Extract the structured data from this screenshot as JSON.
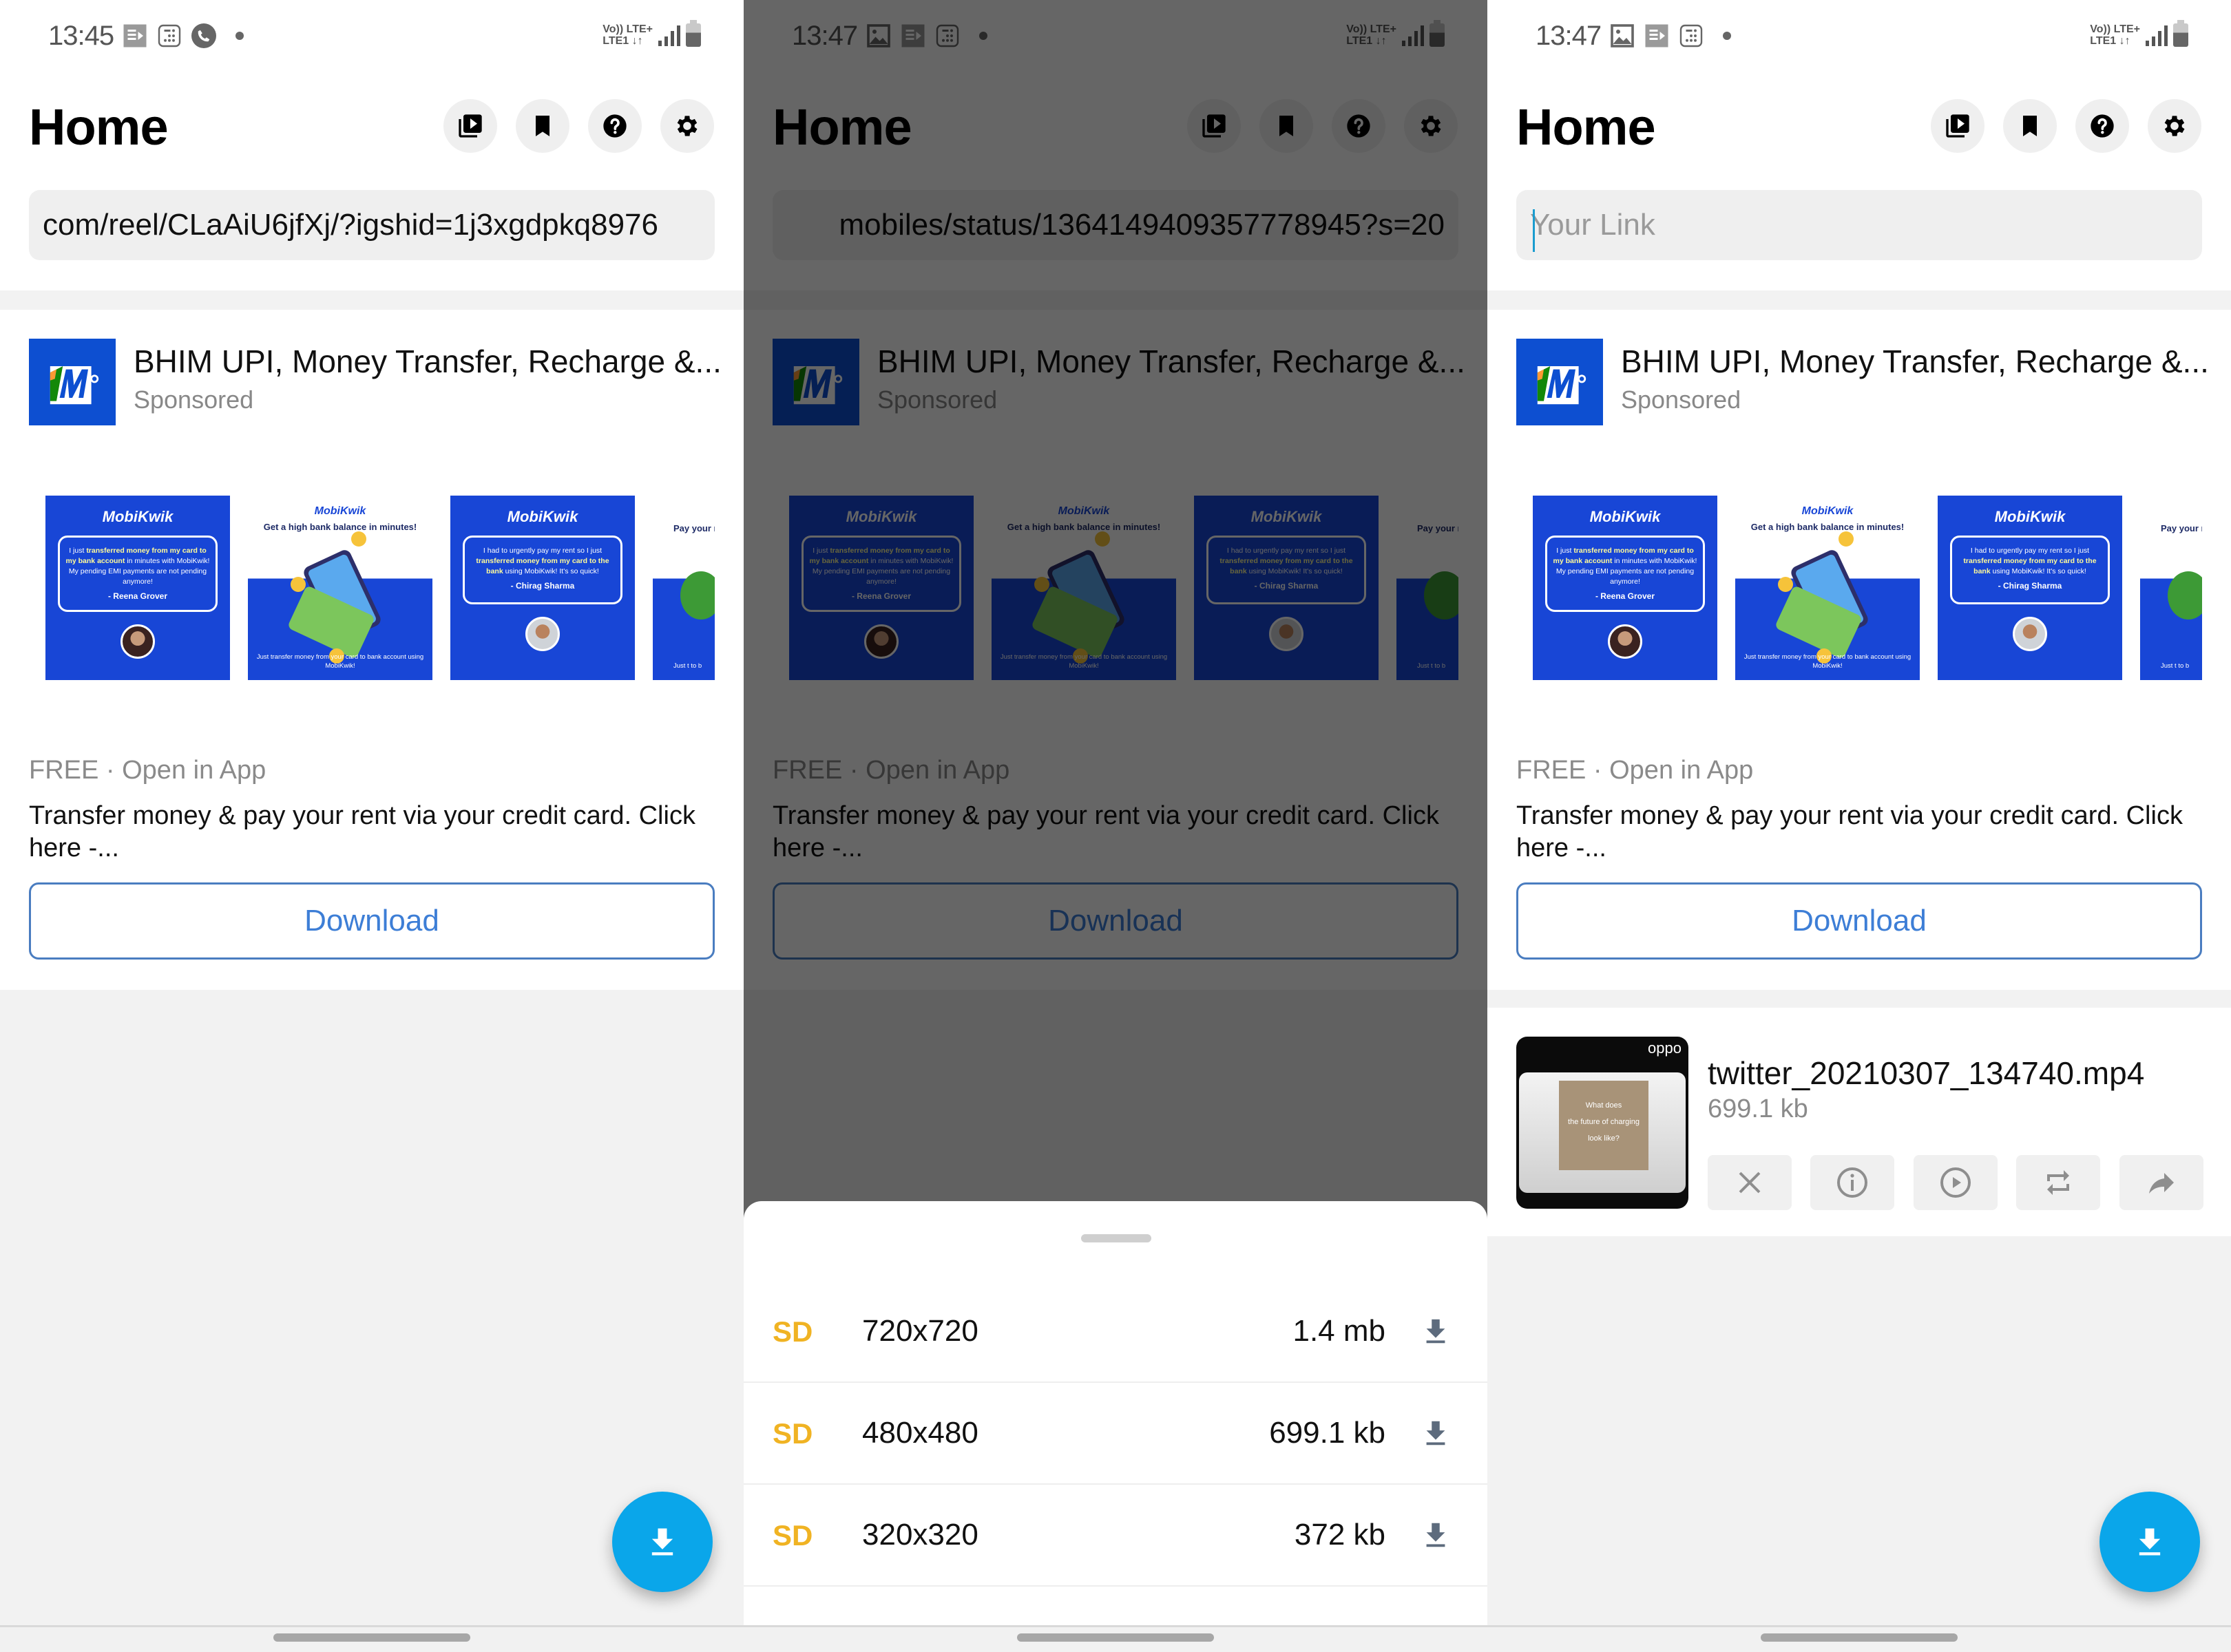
{
  "panels": [
    {
      "status": {
        "time": "13:45",
        "notif_icons": [
          "media-icon",
          "calendar-icon",
          "phone-call-icon"
        ],
        "network_line1": "Vo)) LTE+",
        "network_line2": "LTE1 ↓↑"
      },
      "header": {
        "title": "Home",
        "buttons": [
          "video-library-icon",
          "bookmark-icon",
          "help-icon",
          "settings-icon"
        ]
      },
      "link_input": {
        "value": "com/reel/CLaAiU6jfXj/?igshid=1j3xgdpkq8976",
        "placeholder": "Your Link"
      }
    },
    {
      "status": {
        "time": "13:47",
        "notif_icons": [
          "gallery-icon",
          "media-icon",
          "calendar-icon"
        ],
        "network_line1": "Vo)) LTE+",
        "network_line2": "LTE1 ↓↑"
      },
      "header": {
        "title": "Home",
        "buttons": [
          "video-library-icon",
          "bookmark-icon",
          "help-icon",
          "settings-icon"
        ]
      },
      "link_input": {
        "value": "mobiles/status/1364149409357778945?s=20",
        "placeholder": "Your Link"
      }
    },
    {
      "status": {
        "time": "13:47",
        "notif_icons": [
          "gallery-icon",
          "media-icon",
          "calendar-icon"
        ],
        "network_line1": "Vo)) LTE+",
        "network_line2": "LTE1 ↓↑"
      },
      "header": {
        "title": "Home",
        "buttons": [
          "video-library-icon",
          "bookmark-icon",
          "help-icon",
          "settings-icon"
        ]
      },
      "link_input": {
        "value": "",
        "placeholder": "Your Link"
      }
    }
  ],
  "ad": {
    "title": "BHIM UPI, Money Transfer, Recharge &...",
    "sponsored": "Sponsored",
    "meta": "FREE · Open in App",
    "description": "Transfer money & pay your rent via your credit card. Click here -...",
    "cta": "Download",
    "screenshots": [
      {
        "brand": "MobiKwik",
        "quote_pre": "I just ",
        "quote_bold": "transferred money from my card to my bank account",
        "quote_post": " in minutes with MobiKwik! My pending EMI payments are not pending anymore!",
        "author": "- Reena Grover"
      },
      {
        "brand": "MobiKwik",
        "headline": "Get a high bank balance in minutes!",
        "footer": "Just transfer money from your card to bank account using MobiKwik!"
      },
      {
        "brand": "MobiKwik",
        "quote_pre": "I had to urgently pay my rent so I just ",
        "quote_bold": "transferred money from my card to the bank",
        "quote_post": " using MobiKwik! It's so quick!",
        "author": "- Chirag Sharma"
      },
      {
        "headline": "Pay your r",
        "footer": "Just t to b"
      }
    ]
  },
  "quality_sheet": {
    "options": [
      {
        "badge": "SD",
        "resolution": "720x720",
        "size": "1.4 mb"
      },
      {
        "badge": "SD",
        "resolution": "480x480",
        "size": "699.1 kb"
      },
      {
        "badge": "SD",
        "resolution": "320x320",
        "size": "372 kb"
      }
    ]
  },
  "downloaded_file": {
    "name": "twitter_20210307_134740.mp4",
    "size": "699.1 kb",
    "thumb_brand": "oppo",
    "thumb_text_1": "What does",
    "thumb_text_2": "the future of charging",
    "thumb_text_3": "look like?",
    "actions": [
      "delete-icon",
      "info-icon",
      "play-icon",
      "convert-icon",
      "share-icon"
    ]
  },
  "fab": {
    "icon": "download-icon"
  },
  "colors": {
    "accent": "#0aa6ea",
    "cta_border": "#4a7dc0",
    "cta_text": "#3d7ed6",
    "sd_badge": "#f0b323",
    "ad_brand": "#1846d6"
  }
}
